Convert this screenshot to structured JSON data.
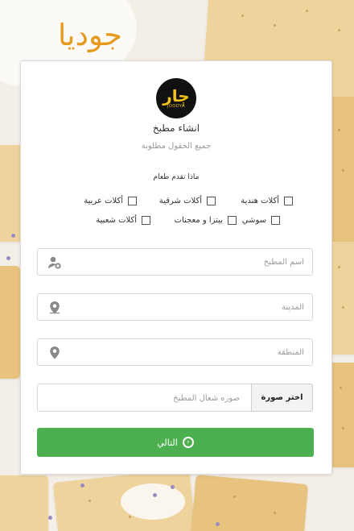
{
  "brand": {
    "name": "جوديا"
  },
  "logo": {
    "glyph": "ڄار",
    "word": "JOODYA"
  },
  "form": {
    "title": "انشاء مطبخ",
    "subtitle": "جميع الحقول مطلوبة",
    "question": "ماذا تقدم طعام",
    "options": [
      {
        "label": "أكلات هندية",
        "checked": false
      },
      {
        "label": "أكلات شرقية",
        "checked": false
      },
      {
        "label": "أكلات عربية",
        "checked": false
      },
      {
        "label": "سوشي",
        "checked": false
      },
      {
        "label": "بيتزا و معجنات",
        "checked": false
      },
      {
        "label": "أكلات شعبية",
        "checked": false
      }
    ],
    "fields": {
      "kitchen_name": {
        "placeholder": "اسم المطبخ",
        "value": "",
        "icon": "add-user-icon"
      },
      "city": {
        "placeholder": "المدينة",
        "value": "",
        "icon": "map-pin-icon"
      },
      "region": {
        "placeholder": "المنطقة",
        "value": "",
        "icon": "map-pin-icon"
      }
    },
    "logo_upload": {
      "placeholder": "صوره شعال المطبخ",
      "button": "اختر صورة"
    },
    "next_button": {
      "label": "التالي",
      "icon": "chevron-left-circle-icon"
    }
  },
  "colors": {
    "brand": "#e59a1c",
    "primary": "#4caf50",
    "logo_bg": "#111111",
    "logo_fg": "#f3c11b"
  }
}
